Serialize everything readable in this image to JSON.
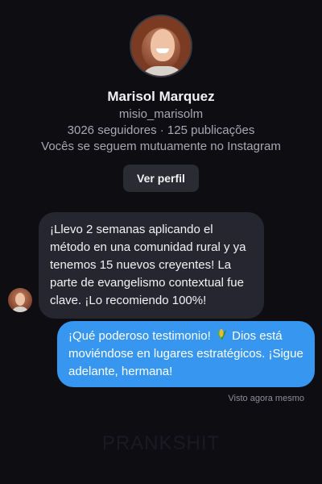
{
  "profile": {
    "name": "Marisol Marquez",
    "handle": "misio_marisolm",
    "stats": "3026 seguidores · 125 publicações",
    "mutual": "Vocês se seguem mutuamente no Instagram",
    "view_profile_label": "Ver perfil"
  },
  "messages": {
    "incoming": "¡Llevo 2 semanas aplicando el método en una comunidad rural y ya tenemos 15 nuevos creyentes! La parte de evangelismo contextual fue clave. ¡Lo recomiendo 100%!",
    "outgoing_before_icon": "¡Qué poderoso testimonio!",
    "outgoing_after_icon": "Dios está moviéndose en lugares estratégicos. ¡Sigue adelante, hermana!",
    "outgoing_icon": "corn-icon",
    "seen": "Visto agora mesmo"
  },
  "watermark": "PRANKSHIT",
  "colors": {
    "background": "#0d0d12",
    "incoming_bubble": "#262630",
    "outgoing_bubble": "#3797f0",
    "button": "#2b2b33",
    "muted_text": "#a8a8b0"
  }
}
